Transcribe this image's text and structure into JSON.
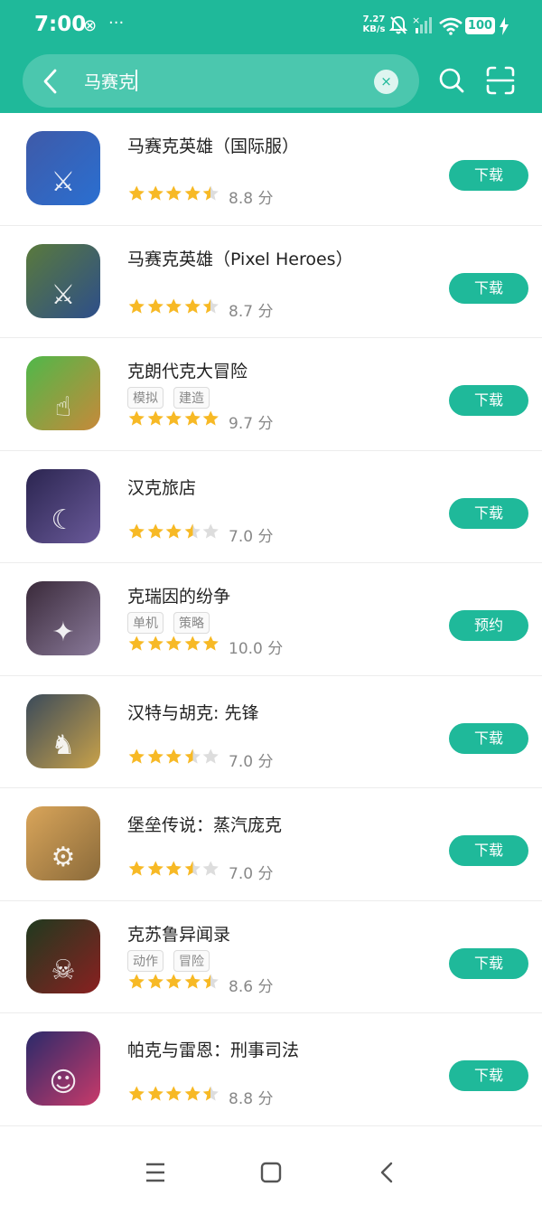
{
  "status_bar": {
    "time": "7:00",
    "extra_icon": "⊗",
    "more": "···",
    "net_speed_value": "7.27",
    "net_speed_unit": "KB/s",
    "battery": "100"
  },
  "search": {
    "query": "马赛克",
    "clear_symbol": "×"
  },
  "colors": {
    "accent": "#1fb99a",
    "star": "#f7b925",
    "star_empty": "#dddddd"
  },
  "apps": [
    {
      "name": "马赛克英雄（国际服）",
      "tags": [],
      "rating": 4.5,
      "score_text": "8.8 分",
      "action": "下载",
      "icon": "pixel-hero-icon",
      "icon_glyph": "⚔",
      "icon_bg": "linear-gradient(135deg,#3f5aa8,#2a6fd1)"
    },
    {
      "name": "马赛克英雄（Pixel Heroes）",
      "tags": [],
      "rating": 4.5,
      "score_text": "8.7 分",
      "action": "下载",
      "icon": "pixel-heroes-icon",
      "icon_glyph": "⚔",
      "icon_bg": "linear-gradient(135deg,#5a7a3c,#2d4e8a)"
    },
    {
      "name": "克朗代克大冒险",
      "tags": [
        "模拟",
        "建造"
      ],
      "rating": 5,
      "score_text": "9.7 分",
      "action": "下载",
      "icon": "klondike-icon",
      "icon_glyph": "☝",
      "icon_bg": "linear-gradient(135deg,#4fb84a,#c7893a)"
    },
    {
      "name": "汉克旅店",
      "tags": [],
      "rating": 3.5,
      "score_text": "7.0 分",
      "action": "下载",
      "icon": "hank-inn-icon",
      "icon_glyph": "☾",
      "icon_bg": "linear-gradient(135deg,#2b2550,#6a5a9a)"
    },
    {
      "name": "克瑞因的纷争",
      "tags": [
        "单机",
        "策略"
      ],
      "rating": 5,
      "score_text": "10.0 分",
      "action": "预约",
      "icon": "krein-dispute-icon",
      "icon_glyph": "✦",
      "icon_bg": "linear-gradient(135deg,#3a2a3a,#8a7a9a)"
    },
    {
      "name": "汉特与胡克: 先锋",
      "tags": [],
      "rating": 3.5,
      "score_text": "7.0 分",
      "action": "下载",
      "icon": "hunter-hook-icon",
      "icon_glyph": "♞",
      "icon_bg": "linear-gradient(135deg,#3a4a5a,#c9a24a)"
    },
    {
      "name": "堡垒传说：蒸汽庞克",
      "tags": [],
      "rating": 3.5,
      "score_text": "7.0 分",
      "action": "下载",
      "icon": "fortress-legend-icon",
      "icon_glyph": "⚙",
      "icon_bg": "linear-gradient(135deg,#d9a55a,#8a6a3a)"
    },
    {
      "name": "克苏鲁异闻录",
      "tags": [
        "动作",
        "冒险"
      ],
      "rating": 4.5,
      "score_text": "8.6 分",
      "action": "下载",
      "icon": "cthulhu-icon",
      "icon_glyph": "☠",
      "icon_bg": "linear-gradient(135deg,#1f3a1f,#8a2020)"
    },
    {
      "name": "帕克与雷恩：刑事司法",
      "tags": [],
      "rating": 4.5,
      "score_text": "8.8 分",
      "action": "下载",
      "icon": "parker-lane-icon",
      "icon_glyph": "☺",
      "icon_bg": "linear-gradient(135deg,#2a2a6a,#c93a6a)"
    }
  ]
}
